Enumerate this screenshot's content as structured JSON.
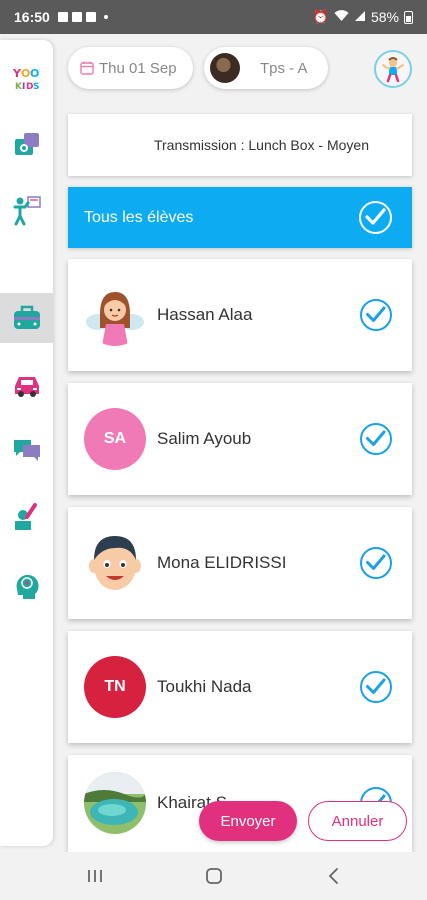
{
  "status_bar": {
    "time": "16:50",
    "battery": "58%"
  },
  "sidebar": {
    "items": [
      {
        "name": "app-logo-icon"
      },
      {
        "name": "photos-icon"
      },
      {
        "name": "teacher-board-icon"
      },
      {
        "name": "lunchbox-icon",
        "active": true
      },
      {
        "name": "bus-icon"
      },
      {
        "name": "chat-icon"
      },
      {
        "name": "pointing-student-icon"
      },
      {
        "name": "brain-icon"
      }
    ]
  },
  "header": {
    "date": "Thu 01 Sep",
    "class_name": "Tps - A"
  },
  "transmission": {
    "label": "Transmission : Lunch Box - Moyen"
  },
  "select_all": {
    "label": "Tous les élèves",
    "checked": true
  },
  "students": [
    {
      "name": "Hassan Alaa",
      "avatar": "illustration-girl",
      "checked": true
    },
    {
      "name": "Salim Ayoub",
      "initials": "SA",
      "avatar_color": "#f07ab5",
      "checked": true
    },
    {
      "name": "Mona ELIDRISSI",
      "avatar": "illustration-boy",
      "checked": true
    },
    {
      "name": "Toukhi Nada",
      "initials": "TN",
      "avatar_color": "#d6223e",
      "checked": true
    },
    {
      "name": "Khairat  S",
      "avatar": "photo-lake",
      "checked": true
    }
  ],
  "actions": {
    "send": "Envoyer",
    "cancel": "Annuler"
  },
  "colors": {
    "accent_blue": "#0dacf2",
    "check_blue": "#1ba1e6",
    "brand_pink": "#e0307e",
    "teal": "#1fa7a0"
  }
}
